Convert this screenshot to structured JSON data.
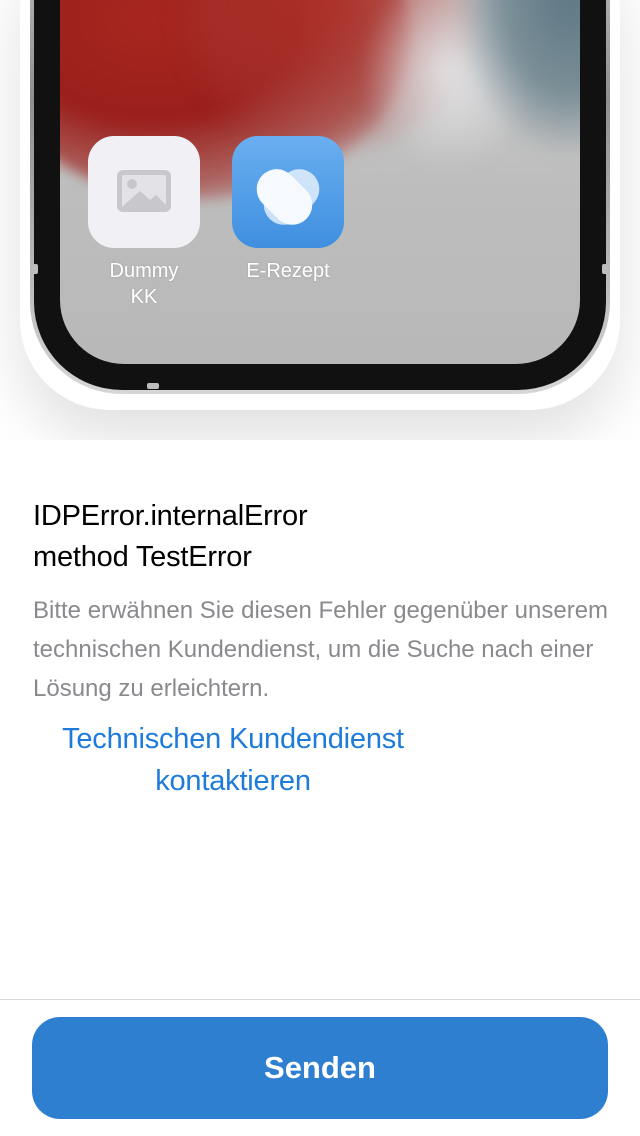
{
  "illustration": {
    "apps": [
      {
        "label": "Dummy KK",
        "icon": "image-placeholder-icon"
      },
      {
        "label": "E-Rezept",
        "icon": "e-rezept-heart-icon"
      }
    ]
  },
  "error": {
    "title_line1": "IDPError.internalError",
    "title_line2": "method TestError",
    "description": "Bitte erwähnen Sie diesen Fehler gegenüber unserem technischen Kundendienst, um die Suche nach einer Lösung zu erleichtern.",
    "support_link": "Technischen Kundendienst kontaktieren"
  },
  "actions": {
    "send_label": "Senden"
  },
  "colors": {
    "accent": "#2f7fd0",
    "link": "#1e7bd9",
    "secondary_text": "#8a8a8e"
  }
}
